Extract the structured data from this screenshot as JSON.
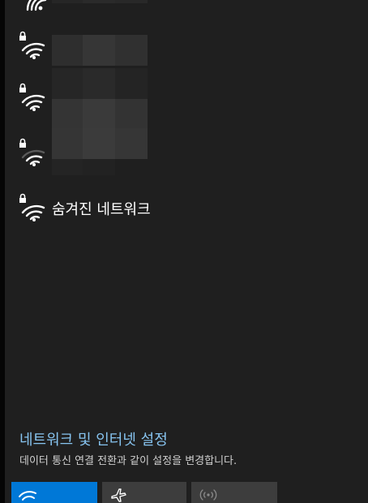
{
  "networks": [
    {
      "kind": "secured",
      "signal": 4,
      "name_visible": false
    },
    {
      "kind": "secured",
      "signal": 4,
      "name_visible": false
    },
    {
      "kind": "secured",
      "signal": 4,
      "name_visible": false
    },
    {
      "kind": "secured",
      "signal": 2,
      "name_visible": false
    },
    {
      "kind": "secured",
      "signal": 4,
      "name_visible": true,
      "label": "숨겨진 네트워크"
    }
  ],
  "icons": {
    "network": "wifi-lock-icon",
    "quick_actions": [
      "wifi-icon",
      "airplane-icon",
      "mobile-hotspot-icon"
    ]
  },
  "settings": {
    "link_label": "네트워크 및 인터넷 설정",
    "description": "데이터 통신 연결 전환과 같이 설정을 변경합니다."
  },
  "quick_actions": [
    {
      "name": "wifi",
      "state": "on"
    },
    {
      "name": "airplane",
      "state": "off"
    },
    {
      "name": "mobile-hotspot",
      "state": "off"
    }
  ],
  "colors": {
    "background": "#1f1f1f",
    "link": "#87c4f0",
    "accent": "#0078d7",
    "tile_off": "#3d3d3d",
    "text": "#ffffff"
  }
}
